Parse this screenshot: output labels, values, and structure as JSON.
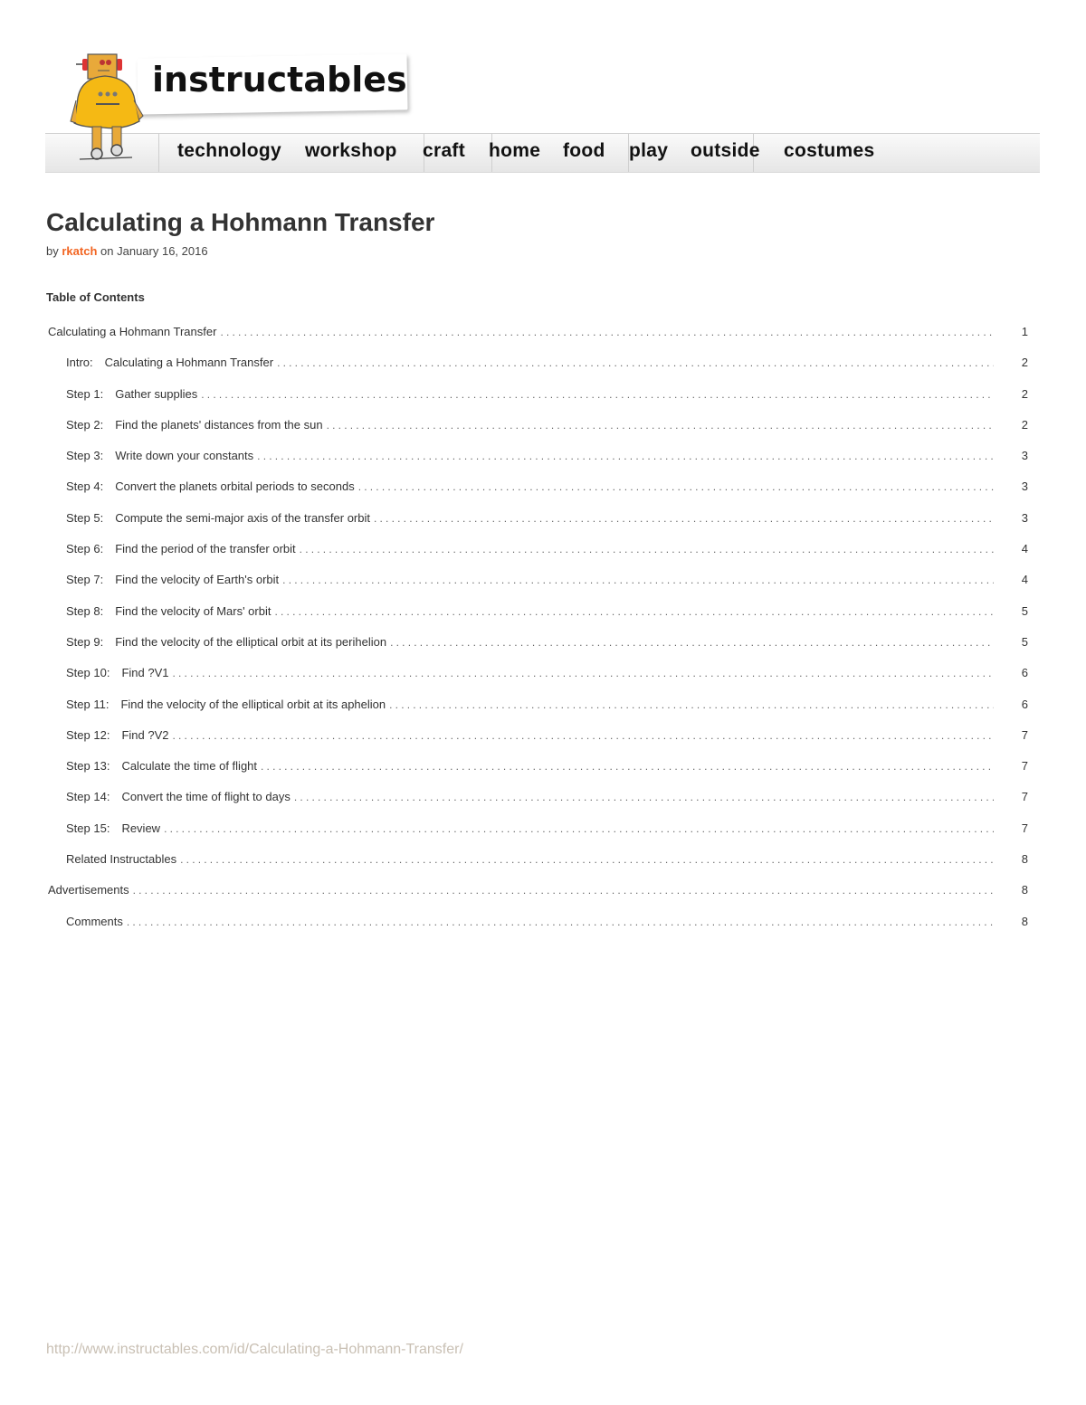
{
  "header": {
    "logo_text": "instructables",
    "nav": [
      {
        "label": "technology"
      },
      {
        "label": "workshop"
      },
      {
        "label": "craft"
      },
      {
        "label": "home"
      },
      {
        "label": "food"
      },
      {
        "label": "play"
      },
      {
        "label": "outside"
      },
      {
        "label": "costumes"
      }
    ],
    "colors": {
      "accent": "#f26522",
      "robot_yellow": "#f5b914"
    }
  },
  "article": {
    "title": "Calculating a Hohmann Transfer",
    "by_prefix": "by",
    "author": "rkatch",
    "date_prefix": "on",
    "date": "January 16, 2016"
  },
  "toc": {
    "heading": "Table of Contents",
    "entries": [
      {
        "prefix": "",
        "label": "Calculating a Hohmann Transfer",
        "page": "1",
        "level": 0
      },
      {
        "prefix": "Intro:",
        "label": "Calculating a Hohmann Transfer",
        "page": "2",
        "level": 1
      },
      {
        "prefix": "Step 1:",
        "label": "Gather supplies",
        "page": "2",
        "level": 1
      },
      {
        "prefix": "Step 2:",
        "label": "Find the planets' distances from the sun",
        "page": "2",
        "level": 1
      },
      {
        "prefix": "Step 3:",
        "label": "Write down your constants",
        "page": "3",
        "level": 1
      },
      {
        "prefix": "Step 4:",
        "label": "Convert the planets orbital periods to seconds",
        "page": "3",
        "level": 1
      },
      {
        "prefix": "Step 5:",
        "label": "Compute the semi-major axis of the transfer orbit",
        "page": "3",
        "level": 1
      },
      {
        "prefix": "Step 6:",
        "label": "Find the period of the transfer orbit",
        "page": "4",
        "level": 1
      },
      {
        "prefix": "Step 7:",
        "label": "Find the velocity of Earth's orbit",
        "page": "4",
        "level": 1
      },
      {
        "prefix": "Step 8:",
        "label": "Find the velocity of Mars' orbit",
        "page": "5",
        "level": 1
      },
      {
        "prefix": "Step 9:",
        "label": "Find the velocity of the elliptical orbit at its perihelion",
        "page": "5",
        "level": 1
      },
      {
        "prefix": "Step 10:",
        "label": "Find ?V1",
        "page": "6",
        "level": 1
      },
      {
        "prefix": "Step 11:",
        "label": "Find the velocity of the elliptical orbit at its aphelion",
        "page": "6",
        "level": 1
      },
      {
        "prefix": "Step 12:",
        "label": "Find ?V2",
        "page": "7",
        "level": 1
      },
      {
        "prefix": "Step 13:",
        "label": "Calculate the time of flight",
        "page": "7",
        "level": 1
      },
      {
        "prefix": "Step 14:",
        "label": "Convert the time of flight to days",
        "page": "7",
        "level": 1
      },
      {
        "prefix": "Step 15:",
        "label": "Review",
        "page": "7",
        "level": 1
      },
      {
        "prefix": "",
        "label": "Related Instructables",
        "page": "8",
        "level": 1
      },
      {
        "prefix": "",
        "label": "Advertisements",
        "page": "8",
        "level": 0
      },
      {
        "prefix": "",
        "label": "Comments",
        "page": "8",
        "level": 1
      }
    ]
  },
  "footer": {
    "url": "http://www.instructables.com/id/Calculating-a-Hohmann-Transfer/"
  }
}
